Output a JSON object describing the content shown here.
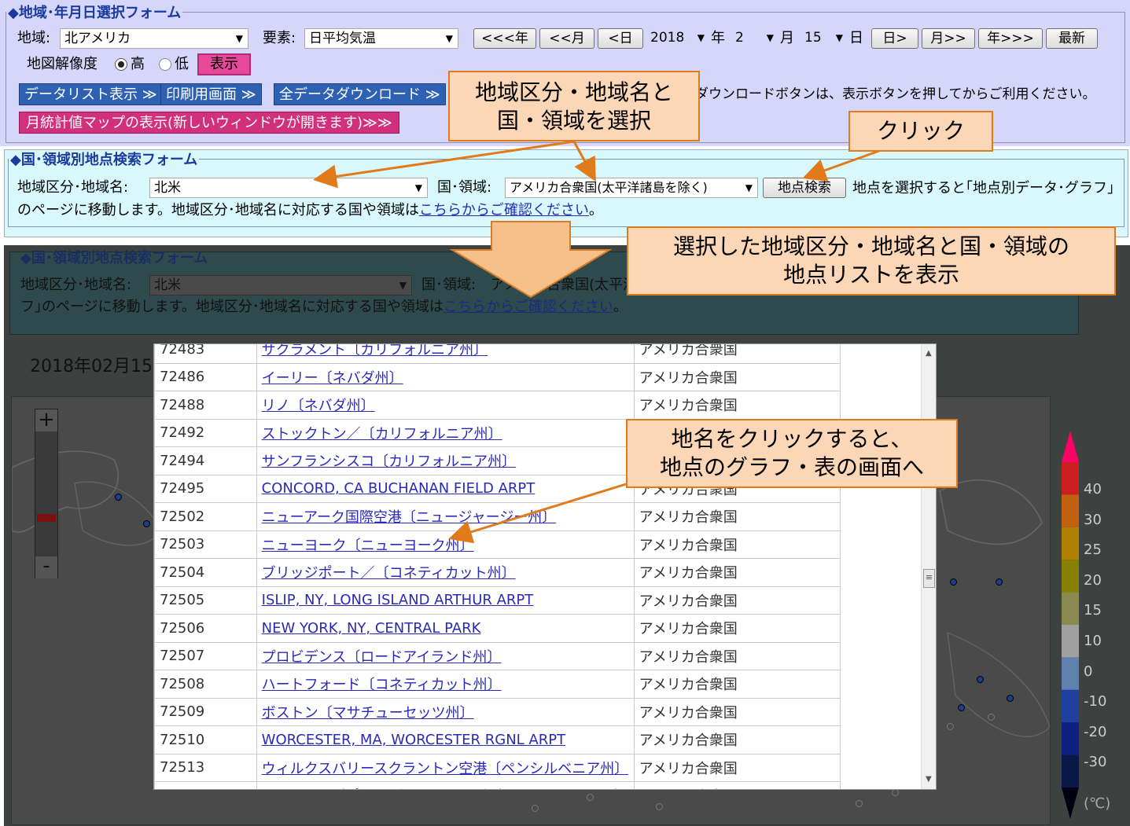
{
  "date_form": {
    "legend": "◆地域･年月日選択フォーム",
    "region_label": "地域:",
    "region_value": "北アメリカ",
    "element_label": "要素:",
    "element_value": "日平均気温",
    "nav_prev_year": "<<<年",
    "nav_prev_month": "<<月",
    "nav_prev_day": "<日",
    "year_value": "2018",
    "year_unit": "年",
    "month_value": "2",
    "month_unit": "月",
    "day_value": "15",
    "day_unit": "日",
    "nav_next_day": "日>",
    "nav_next_month": "月>>",
    "nav_next_year": "年>>>",
    "latest": "最新",
    "map_resolution_label": "地図解像度",
    "res_high": "高",
    "res_low": "低",
    "show_button": "表示",
    "data_list_button": "データリスト表示 ≫",
    "print_button": "印刷用画面 ≫",
    "download_button": "全データダウンロード ≫",
    "download_note": "ダウンロードボタンは、表示ボタンを押してからご利用ください。",
    "monthly_map_button": "月統計値マップの表示(新しいウィンドウが開きます)≫≫"
  },
  "station_form": {
    "legend": "◆国･領域別地点検索フォーム",
    "area_label": "地域区分･地域名:",
    "area_value": "北米",
    "country_label": "国･領域:",
    "country_value": "アメリカ合衆国(太平洋諸島を除く)",
    "search_button": "地点検索",
    "note_text": "地点を選択すると｢地点別データ･グラフ｣のページに移動します。地域区分･地域名に対応する国や領域は",
    "note_link": "こちらからご確認ください",
    "note_end": "。"
  },
  "dim_form": {
    "legend": "◆国･領域別地点検索フォーム",
    "area_label": "地域区分･地域名:",
    "area_value": "北米",
    "country_label": "国･領域:",
    "country_value": "アメリカ合衆国(太平洋",
    "note_text": "フ｣のページに移動します。地域区分･地域名に対応する国や領域は",
    "note_link": "こちらからご確認ください",
    "note_end": "。",
    "date_heading": "2018年02月15"
  },
  "callouts": {
    "select_region": "地域区分・地域名と\n国・領域を選択",
    "click": "クリック",
    "show_list": "選択した地域区分・地域名と国・領域の\n地点リストを表示",
    "click_name": "地名をクリックすると、\n地点のグラフ・表の画面へ"
  },
  "stations": [
    {
      "id": "72483",
      "name": "サクラメント〔カリフォルニア州〕",
      "country": "アメリカ合衆国"
    },
    {
      "id": "72486",
      "name": "イーリー〔ネバダ州〕",
      "country": "アメリカ合衆国"
    },
    {
      "id": "72488",
      "name": "リノ〔ネバダ州〕",
      "country": "アメリカ合衆国"
    },
    {
      "id": "72492",
      "name": "ストックトン／〔カリフォルニア州〕",
      "country": "アメリカ合衆国"
    },
    {
      "id": "72494",
      "name": "サンフランシスコ〔カリフォルニア州〕",
      "country": "アメリカ合衆国"
    },
    {
      "id": "72495",
      "name": "CONCORD, CA BUCHANAN FIELD ARPT",
      "country": "アメリカ合衆国"
    },
    {
      "id": "72502",
      "name": "ニューアーク国際空港〔ニュージャージー州〕",
      "country": "アメリカ合衆国"
    },
    {
      "id": "72503",
      "name": "ニューヨーク〔ニューヨーク州〕",
      "country": "アメリカ合衆国"
    },
    {
      "id": "72504",
      "name": "ブリッジポート／〔コネティカット州〕",
      "country": "アメリカ合衆国"
    },
    {
      "id": "72505",
      "name": "ISLIP, NY, LONG ISLAND ARTHUR ARPT",
      "country": "アメリカ合衆国"
    },
    {
      "id": "72506",
      "name": "NEW YORK, NY, CENTRAL PARK",
      "country": "アメリカ合衆国"
    },
    {
      "id": "72507",
      "name": "プロビデンス〔ロードアイランド州〕",
      "country": "アメリカ合衆国"
    },
    {
      "id": "72508",
      "name": "ハートフォード〔コネティカット州〕",
      "country": "アメリカ合衆国"
    },
    {
      "id": "72509",
      "name": "ボストン〔マサチューセッツ州〕",
      "country": "アメリカ合衆国"
    },
    {
      "id": "72510",
      "name": "WORCESTER, MA, WORCESTER RGNL ARPT",
      "country": "アメリカ合衆国"
    },
    {
      "id": "72513",
      "name": "ウィルクスバリースクラントン空港〔ペンシルベニア州〕",
      "country": "アメリカ合衆国"
    },
    {
      "id": "72514",
      "name": "ウィリアムズポート／ライカミング〔ペンシルベニア州〕",
      "country": "アメリカ合衆国"
    }
  ],
  "color_legend": {
    "ticks": [
      "40",
      "30",
      "25",
      "20",
      "15",
      "10",
      "0",
      "-10",
      "-20",
      "-30"
    ],
    "unit": "(℃)",
    "colors": [
      "#ff0066",
      "#cc2020",
      "#c06010",
      "#b08000",
      "#888000",
      "#8a8a50",
      "#a0a0a0",
      "#6080b0",
      "#2040a0",
      "#102080",
      "#081848",
      "#000010"
    ]
  },
  "map_controls": {
    "zoom_in": "+",
    "zoom_out": "-"
  }
}
